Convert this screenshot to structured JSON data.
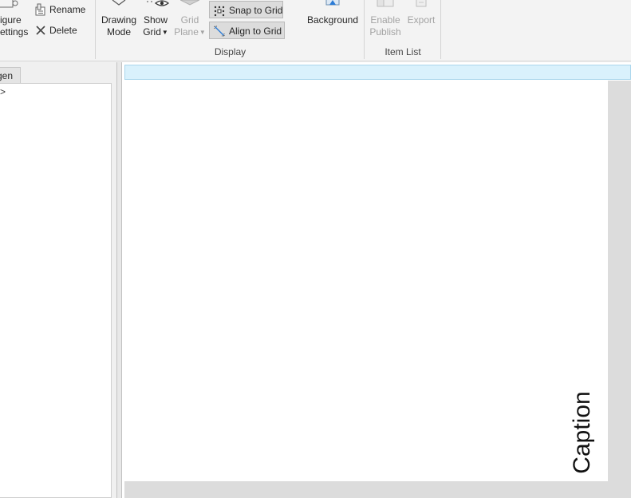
{
  "ribbon": {
    "figure_settings": {
      "line1": "igure",
      "line2": "ettings"
    },
    "rename_label": "Rename",
    "delete_label": "Delete",
    "drawing_mode": {
      "line1": "Drawing",
      "line2": "Mode"
    },
    "show_grid": {
      "line1": "Show",
      "line2": "Grid"
    },
    "grid_plane": {
      "line1": "Grid",
      "line2": "Plane"
    },
    "snap_to_grid_label": "Snap to Grid",
    "align_to_grid_label": "Align to Grid",
    "background_label": "Background",
    "enable_publish": {
      "line1": "Enable",
      "line2": "Publish"
    },
    "export_label": "Export",
    "groups": {
      "display": "Display",
      "item_list": "Item List"
    }
  },
  "left_panel": {
    "tab_label": "gen",
    "tree_item": ">"
  },
  "canvas": {
    "caption_text": "Caption"
  }
}
